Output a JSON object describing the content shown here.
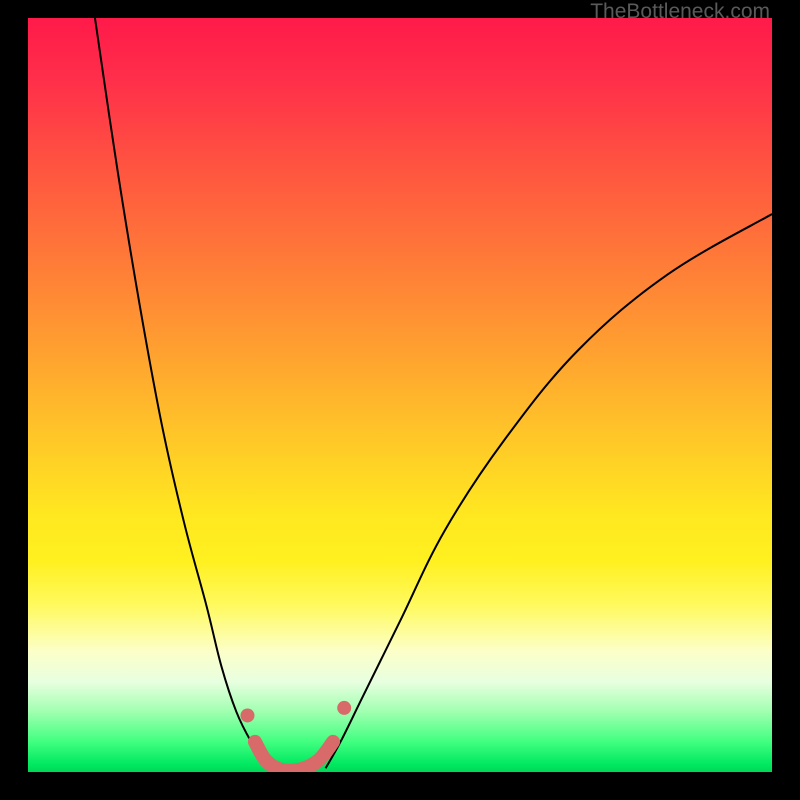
{
  "watermark": "TheBottleneck.com",
  "chart_data": {
    "type": "line",
    "title": "",
    "xlabel": "",
    "ylabel": "",
    "xlim": [
      0,
      100
    ],
    "ylim": [
      0,
      100
    ],
    "background_gradient": {
      "orientation": "vertical",
      "stops": [
        {
          "pos": 0,
          "color": "#ff1a4a"
        },
        {
          "pos": 50,
          "color": "#ffc020"
        },
        {
          "pos": 80,
          "color": "#fff060"
        },
        {
          "pos": 95,
          "color": "#60ff80"
        },
        {
          "pos": 100,
          "color": "#00d858"
        }
      ]
    },
    "series": [
      {
        "name": "left-curve",
        "color": "#000000",
        "stroke_width": 2,
        "x": [
          9,
          12,
          15,
          18,
          21,
          24,
          26,
          28,
          30,
          31.5,
          33
        ],
        "y": [
          100,
          80,
          62,
          46,
          33,
          22,
          14,
          8,
          4,
          2,
          0.5
        ]
      },
      {
        "name": "right-curve",
        "color": "#000000",
        "stroke_width": 2,
        "x": [
          40,
          42,
          45,
          50,
          56,
          64,
          74,
          86,
          100
        ],
        "y": [
          0.5,
          4,
          10,
          20,
          32,
          44,
          56,
          66,
          74
        ]
      },
      {
        "name": "bottom-highlight",
        "color": "#d86a6a",
        "stroke_width": 14,
        "linecap": "round",
        "x": [
          30.5,
          32,
          34,
          36.5,
          39,
          41
        ],
        "y": [
          4,
          1.5,
          0.3,
          0.3,
          1.5,
          4
        ]
      }
    ],
    "markers": [
      {
        "x": 29.5,
        "y": 7.5,
        "color": "#d86a6a",
        "radius": 7
      },
      {
        "x": 42.5,
        "y": 8.5,
        "color": "#d86a6a",
        "radius": 7
      }
    ]
  }
}
